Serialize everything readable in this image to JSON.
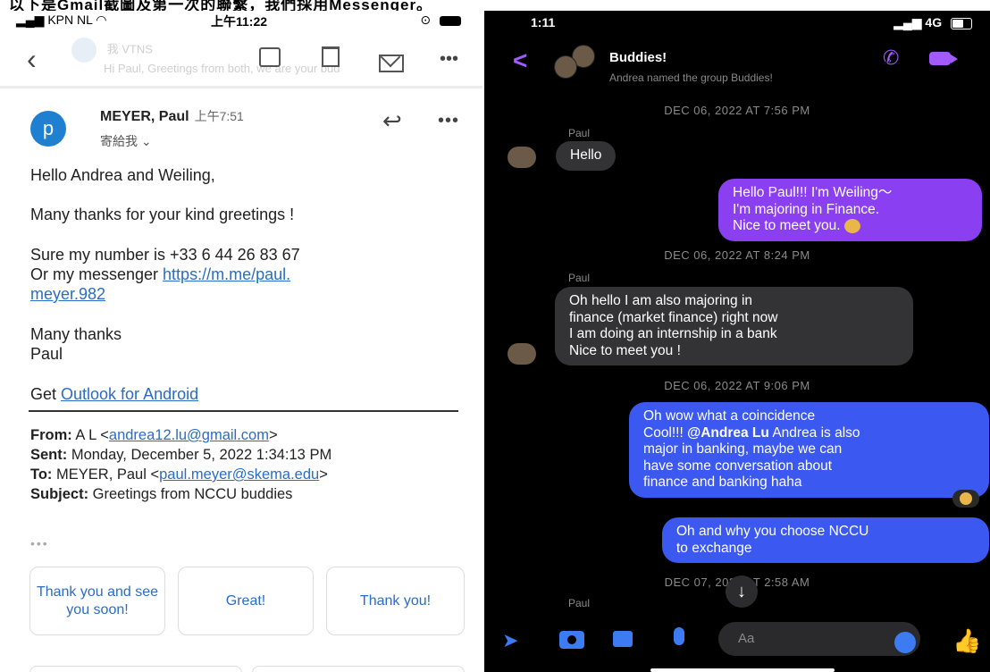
{
  "caption": "以下是Gmail截圖及第一次的聯繫，我們採用Messenger。",
  "email": {
    "status": {
      "carrier": "KPN NL",
      "time": "上午11:22"
    },
    "faded_header": {
      "sender": "我 VTNS",
      "preview": "Hi Paul, Greetings from both, we are your bud"
    },
    "sender": {
      "initial": "p",
      "name": "MEYER, Paul",
      "time": "上午7:51",
      "to": "寄給我 ⌄"
    },
    "body": {
      "greeting": "Hello Andrea and Weiling,",
      "thanks": "Many thanks for your kind greetings !",
      "number_line": "Sure my number is +33 6 44 26 83 67",
      "messenger_prefix": "Or my messenger ",
      "messenger_link_1": "https://m.me/paul.",
      "messenger_link_2": "meyer.982",
      "closing": "Many thanks",
      "name": "Paul",
      "get_prefix": "Get ",
      "outlook_link": "Outlook for Android"
    },
    "quoted": {
      "from_label": "From:",
      "from_value": " A L <",
      "from_email": "andrea12.lu@gmail.com",
      "from_close": ">",
      "sent_label": "Sent:",
      "sent_value": " Monday, December 5, 2022 1:34:13 PM",
      "to_label": "To:",
      "to_value": " MEYER, Paul <",
      "to_email": "paul.meyer@skema.edu",
      "to_close": ">",
      "subject_label": "Subject:",
      "subject_value": " Greetings from NCCU buddies"
    },
    "ellipsis": "•••",
    "smart_replies": [
      "Thank you and see you soon!",
      "Great!",
      "Thank you!"
    ]
  },
  "messenger": {
    "status": {
      "time": "1:11",
      "signal": "4G"
    },
    "header": {
      "title": "Buddies!",
      "subtitle": "Andrea named the group Buddies!"
    },
    "timestamps": [
      "DEC 06, 2022 AT 7:56 PM",
      "DEC 06, 2022 AT 8:24 PM",
      "DEC 06, 2022 AT 9:06 PM",
      "DEC 07, 2022 AT 2:58 AM"
    ],
    "sender_name": "Paul",
    "messages": {
      "m1": "Hello",
      "m2_l1": "Hello Paul!!! I'm Weiling～",
      "m2_l2": "I'm majoring in Finance.",
      "m2_l3": "Nice to meet you.",
      "m3_l1": "Oh hello I am also majoring in",
      "m3_l2": "finance (market finance) right now",
      "m3_l3": "I am doing an internship in a bank",
      "m3_l4": "Nice to meet you !",
      "m4_l1": "Oh wow what a coincidence",
      "m4_l2a": "Cool!!! ",
      "m4_mention": "@Andrea Lu",
      "m4_l2b": " Andrea is also",
      "m4_l3": "major in banking, maybe we can",
      "m4_l4": "have some conversation about",
      "m4_l5": "finance and banking haha",
      "m5_l1": "Oh and why you choose NCCU",
      "m5_l2": "to  exchange"
    },
    "composer_placeholder": "Aa"
  }
}
